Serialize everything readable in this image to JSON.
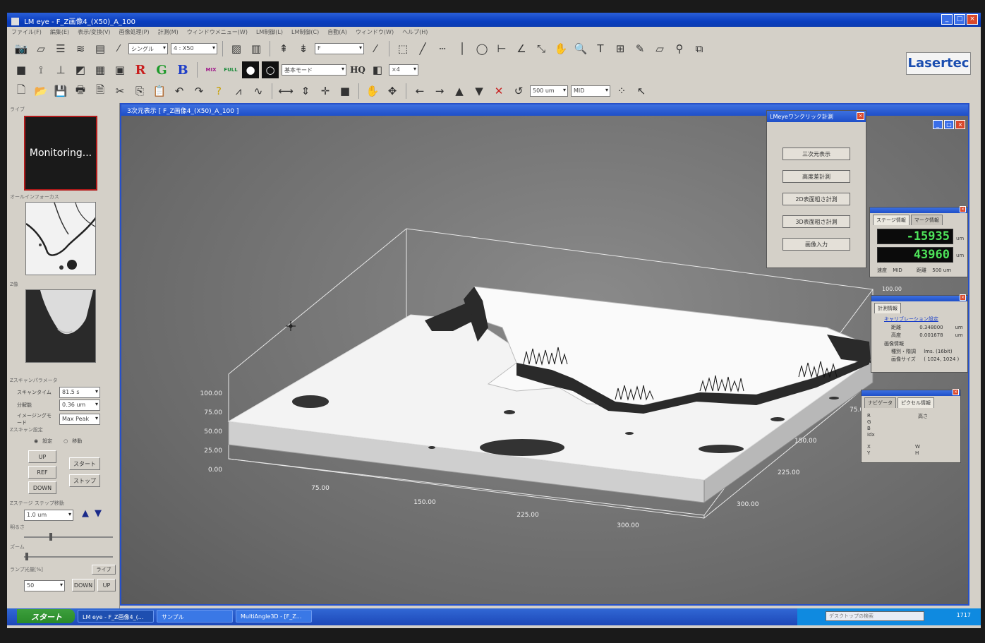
{
  "window": {
    "title": "LM eye - F_Z画像4_(X50)_A_100",
    "btn_min": "_",
    "btn_max": "□",
    "btn_close": "×"
  },
  "menu": [
    "ファイル(F)",
    "編集(E)",
    "表示/変換(V)",
    "画像処理(P)",
    "計測(M)",
    "ウィンドウメニュー(W)",
    "LM制御(L)",
    "LM制御(C)",
    "自動(A)",
    "ウィンドウ(W)",
    "ヘルプ(H)"
  ],
  "toolbar": {
    "mode_combo": "シングル",
    "objective_combo": "4 : X50",
    "focus_combo": "F",
    "basic_mode_combo": "基本モード",
    "hq_label": "HQ",
    "zoom_combo": "×4",
    "rgb_r": "R",
    "rgb_g": "G",
    "rgb_b": "B",
    "mix_label": "MIX",
    "full_label": "FULL",
    "step_combo": "500 um",
    "speed_combo": "MID",
    "logo": "Lasertec"
  },
  "left_panel": {
    "live_label": "ライブ",
    "monitoring_text": "Monitoring...",
    "allfocus_label": "オールインフォーカス",
    "z_image_label": "Z像",
    "zscan_param_label": "Zスキャンパラメータ",
    "scan_time_label": "スキャンタイム",
    "scan_time_value": "81.5 s",
    "resolution_label": "分解能",
    "resolution_value": "0.36 um",
    "imaging_mode_label": "イメージングモード",
    "imaging_mode_value": "Max Peak",
    "zscan_setting_label": "Zスキャン設定",
    "radio_set": "設定",
    "radio_move": "移動",
    "btn_up": "UP",
    "btn_ref": "REF",
    "btn_down": "DOWN",
    "btn_start": "スタート",
    "btn_stop": "ストップ",
    "zstage_step_label": "Zステージ ステップ移動",
    "step_value": "1.0 um",
    "brightness_label": "明るさ",
    "zoom_label": "ズーム",
    "lamp_label": "ランプ光量[%]",
    "live_btn": "ライブ",
    "lamp_value": "50",
    "btn_down2": "DOWN",
    "btn_up2": "UP"
  },
  "doc_window": {
    "title": "3次元表示 [ F_Z画像4_(X50)_A_100 ]"
  },
  "chart_data": {
    "type": "surface3d",
    "z_ticks": [
      "100.00",
      "75.00",
      "50.00",
      "25.00",
      "0.00"
    ],
    "x_ticks": [
      "75.00",
      "150.00",
      "225.00",
      "300.00"
    ],
    "y_ticks": [
      "75.00",
      "150.00",
      "225.00",
      "300.00"
    ],
    "corner_label": "100.00"
  },
  "oneclick_panel": {
    "title": "LMeyeワンクリック計測",
    "buttons": [
      "三次元表示",
      "高度差計測",
      "2D表面粗さ計測",
      "3D表面粗さ計測",
      "画像入力"
    ]
  },
  "stage_panel": {
    "tab_stage": "ステージ情報",
    "tab_mark": "マーク情報",
    "x_value": "-15935",
    "y_value": "43960",
    "unit": "um",
    "speed_label": "速度",
    "speed_value": "MID",
    "distance_label": "距離",
    "distance_value": "500 um"
  },
  "measure_panel": {
    "title": "計測情報",
    "calib_label": "キャリブレーション設定",
    "distance_label": "距離",
    "distance_value": "0.348000",
    "distance_unit": "um",
    "height_label": "高度",
    "height_value": "0.001678",
    "height_unit": "um",
    "image_info_label": "画像情報",
    "kind_label": "種別・階調",
    "kind_value": "lms. (16bit)",
    "size_label": "画像サイズ",
    "size_value": "( 1024, 1024 )"
  },
  "navi_panel": {
    "tab_navi": "ナビゲータ",
    "tab_pixel": "ピクセル情報",
    "r": "R",
    "g": "G",
    "b": "B",
    "idx": "Idx",
    "height_label": "高さ",
    "x": "X",
    "y": "Y",
    "w": "W",
    "h": "H"
  },
  "taskbar": {
    "start": "スタート",
    "items": [
      "LM eye - F_Z画像4_(...",
      "サンプル",
      "MultiAngle3D - [F_Z..."
    ],
    "search_placeholder": "デスクトップの検索",
    "time": "1717"
  }
}
